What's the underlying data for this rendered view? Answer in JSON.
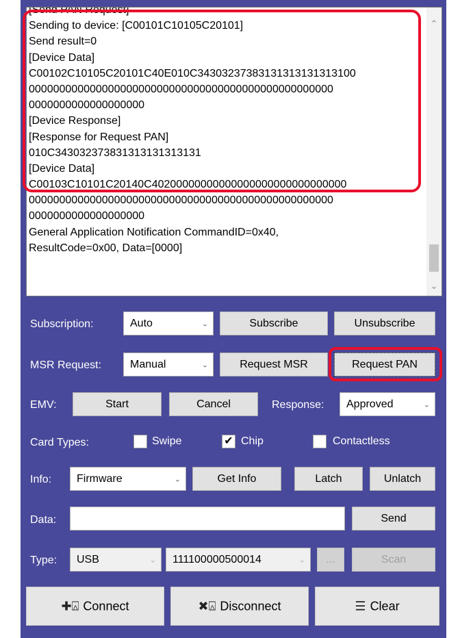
{
  "log": {
    "lines": [
      "[Send PAN Request]",
      "Sending to device: [C00101C10105C20101]",
      "Send result=0",
      "[Device Data]",
      "C00102C10105C20101C40E010C34303237383131313131313100",
      "00000000000000000000000000000000000000000000000000",
      "0000000000000000000",
      "[Device Response]",
      "[Response for Request PAN]",
      "010C343032373831313131313131",
      "[Device Data]",
      "C00103C10101C20140C40200000000000000000000000000000",
      "00000000000000000000000000000000000000000000000000",
      "0000000000000000000",
      "General Application Notification CommandID=0x40,",
      "ResultCode=0x00, Data=[0000]"
    ]
  },
  "subscription": {
    "label": "Subscription:",
    "value": "Auto",
    "subscribe": "Subscribe",
    "unsubscribe": "Unsubscribe"
  },
  "msr": {
    "label": "MSR Request:",
    "value": "Manual",
    "request_msr": "Request MSR",
    "request_pan": "Request PAN"
  },
  "emv": {
    "label": "EMV:",
    "start": "Start",
    "cancel": "Cancel",
    "response_label": "Response:",
    "response_value": "Approved"
  },
  "card_types": {
    "label": "Card Types:",
    "swipe": {
      "label": "Swipe",
      "checked": false
    },
    "chip": {
      "label": "Chip",
      "checked": true
    },
    "contactless": {
      "label": "Contactless",
      "checked": false
    }
  },
  "info": {
    "label": "Info:",
    "value": "Firmware",
    "get_info": "Get Info",
    "latch": "Latch",
    "unlatch": "Unlatch"
  },
  "data": {
    "label": "Data:",
    "value": "",
    "send": "Send"
  },
  "type": {
    "label": "Type:",
    "value": "USB",
    "device": "111100000500014",
    "browse": "...",
    "scan": "Scan"
  },
  "actions": {
    "connect": "Connect",
    "disconnect": "Disconnect",
    "clear": "Clear"
  },
  "colors": {
    "panel": "#48499a",
    "highlight": "#e8102c"
  }
}
